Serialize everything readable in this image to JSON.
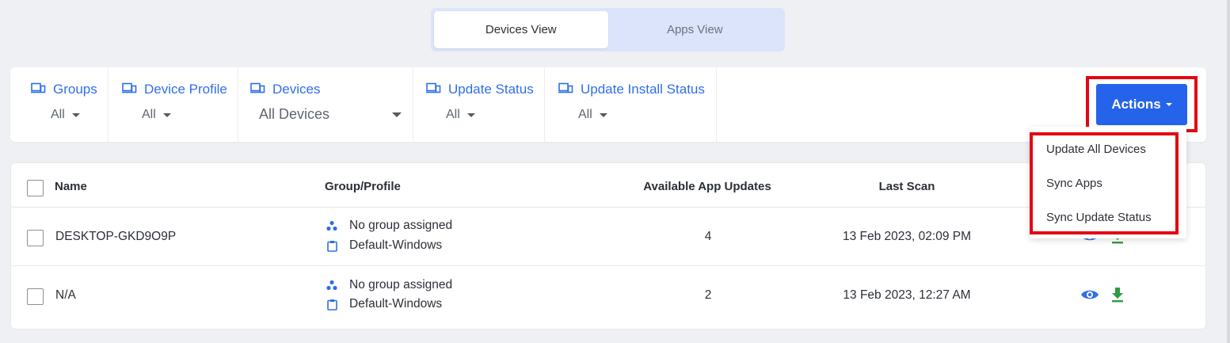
{
  "view_toggle": {
    "tabs": [
      {
        "label": "Devices View",
        "active": true
      },
      {
        "label": "Apps View",
        "active": false
      }
    ]
  },
  "filters": [
    {
      "label": "Groups",
      "value": "All"
    },
    {
      "label": "Device Profile",
      "value": "All"
    },
    {
      "label": "Devices",
      "value": "All Devices"
    },
    {
      "label": "Update Status",
      "value": "All"
    },
    {
      "label": "Update Install Status",
      "value": "All"
    }
  ],
  "actions": {
    "label": "Actions",
    "menu": [
      "Update All Devices",
      "Sync Apps",
      "Sync Update Status"
    ]
  },
  "table": {
    "columns": [
      "Name",
      "Group/Profile",
      "Available App Updates",
      "Last Scan"
    ],
    "rows": [
      {
        "name": "DESKTOP-GKD9O9P",
        "group": "No group assigned",
        "profile": "Default-Windows",
        "updates": "4",
        "last_scan": "13 Feb 2023, 02:09 PM"
      },
      {
        "name": "N/A",
        "group": "No group assigned",
        "profile": "Default-Windows",
        "updates": "2",
        "last_scan": "13 Feb 2023, 12:27 AM"
      }
    ]
  },
  "colors": {
    "accent": "#2f6fe8",
    "button": "#2563eb",
    "highlight": "#e30613",
    "download": "#2e9c3f"
  },
  "icons": [
    "device-icon",
    "caret-down-icon",
    "group-icon",
    "clipboard-icon",
    "eye-icon",
    "download-icon"
  ]
}
